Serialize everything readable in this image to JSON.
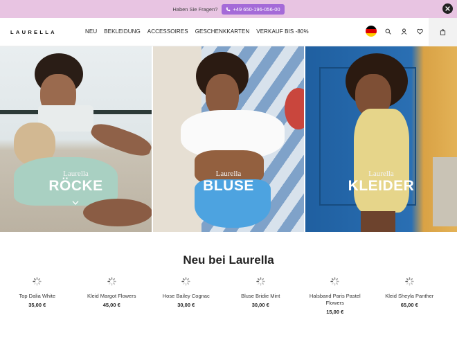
{
  "promo": {
    "text": "Haben Sie Fragen?",
    "phone": "+49 650-196-056-00"
  },
  "header": {
    "logo": "LAURELLA",
    "nav": [
      "NEU",
      "BEKLEIDUNG",
      "ACCESSOIRES",
      "GESCHENKKARTEN",
      "VERKAUF BIS -80%"
    ]
  },
  "tiles": [
    {
      "brand": "Laurella",
      "title": "RÖCKE"
    },
    {
      "brand": "Laurella",
      "title": "BLUSE"
    },
    {
      "brand": "Laurella",
      "title": "KLEIDER"
    }
  ],
  "new_section": {
    "title": "Neu bei Laurella",
    "products": [
      {
        "name": "Top Dalia White",
        "price": "35,00 €"
      },
      {
        "name": "Kleid Margot Flowers",
        "price": "45,00 €"
      },
      {
        "name": "Hose Bailey Cognac",
        "price": "30,00 €"
      },
      {
        "name": "Bluse Bridie Mint",
        "price": "30,00 €"
      },
      {
        "name": "Halsband Paris Pastel Flowers",
        "price": "15,00 €"
      },
      {
        "name": "Kleid Sheyla Panther",
        "price": "65,00 €"
      }
    ]
  },
  "colors": {
    "promo_bg": "#e8c4e2",
    "phone_badge": "#a46ad8",
    "flag": [
      "#000000",
      "#dd0000",
      "#ffce00"
    ]
  },
  "icons": [
    "phone-icon",
    "close-icon",
    "search-icon",
    "account-icon",
    "heart-icon",
    "bag-icon",
    "chevron-down-icon",
    "loading-spinner-icon"
  ]
}
